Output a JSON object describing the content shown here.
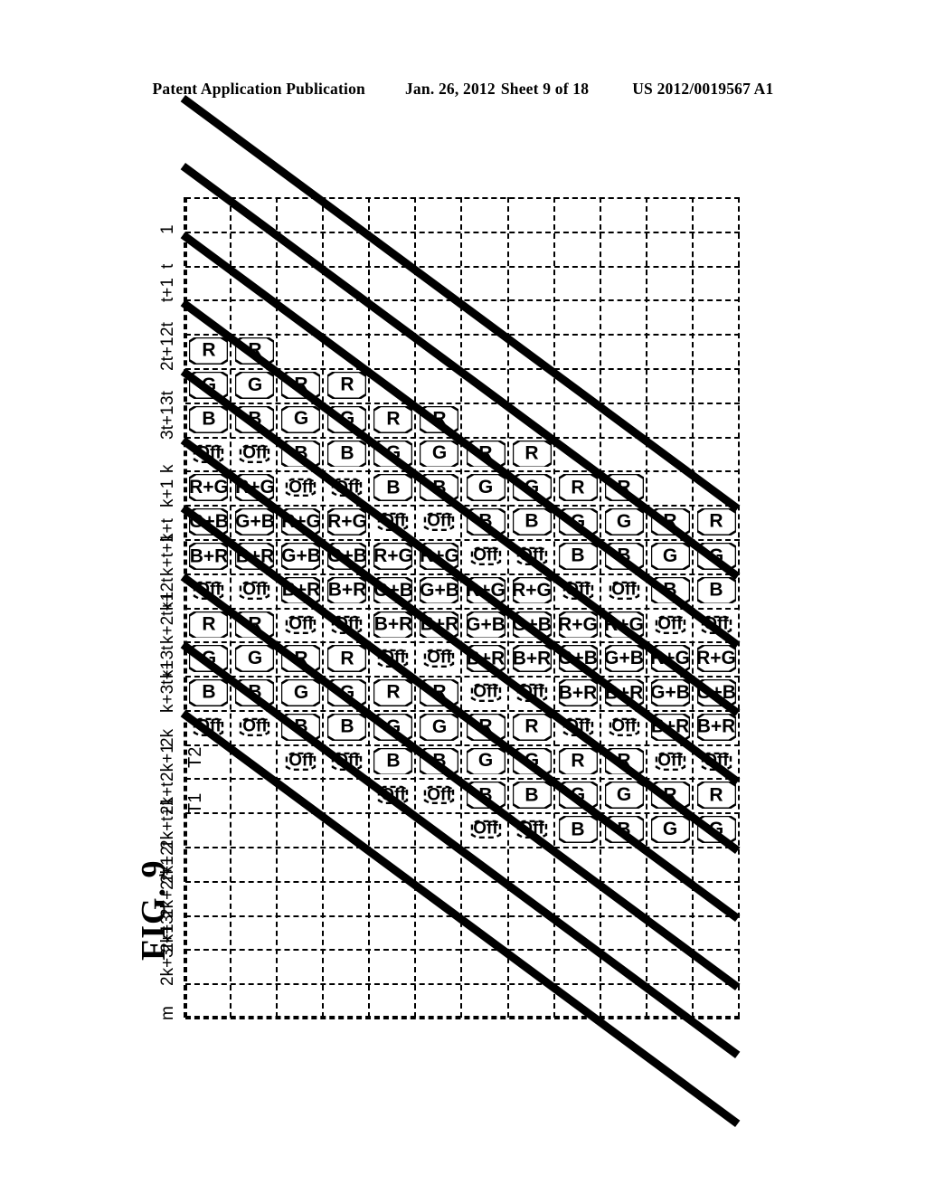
{
  "header": {
    "publication": "Patent Application Publication",
    "date": "Jan. 26, 2012",
    "sheet": "Sheet 9 of 18",
    "number": "US 2012/0019567 A1"
  },
  "figure": {
    "label": "FIG. 9",
    "time_axis_labels": [
      "T1",
      "T2"
    ],
    "cell_states": [
      "R",
      "G",
      "B",
      "Off",
      "R+G",
      "G+B",
      "B+R"
    ],
    "off_state": "Off",
    "row_labels": [
      "1",
      "t",
      "t+1",
      "2t",
      "2t+1",
      "3t",
      "3t+1",
      "k",
      "k+1",
      "k+t",
      "k+t+1",
      "k+2t",
      "k+2t+1",
      "k+3t",
      "k+3t+1",
      "2k",
      "2k+1",
      "2k+t",
      "2k+t+1",
      "2k+2t",
      "2k+2t+1",
      "2k+3t",
      "2k+3t+1",
      "m"
    ],
    "sequence": [
      "R",
      "G",
      "B",
      "Off",
      "R+G",
      "G+B",
      "B+R",
      "Off"
    ],
    "grid": {
      "rows": 24,
      "cols": 12,
      "shift_per_row": 1,
      "blank_before_start": true
    },
    "colors": {
      "ink": "#000000",
      "paper": "#ffffff"
    },
    "columns": [
      {
        "start": 9,
        "count": 10
      },
      {
        "start": 9,
        "count": 10
      },
      {
        "start": 8,
        "count": 11
      },
      {
        "start": 8,
        "count": 11
      },
      {
        "start": 7,
        "count": 12
      },
      {
        "start": 7,
        "count": 12
      },
      {
        "start": 6,
        "count": 12
      },
      {
        "start": 6,
        "count": 12
      },
      {
        "start": 5,
        "count": 12
      },
      {
        "start": 5,
        "count": 12
      },
      {
        "start": 4,
        "count": 12
      },
      {
        "start": 4,
        "count": 12
      }
    ]
  }
}
